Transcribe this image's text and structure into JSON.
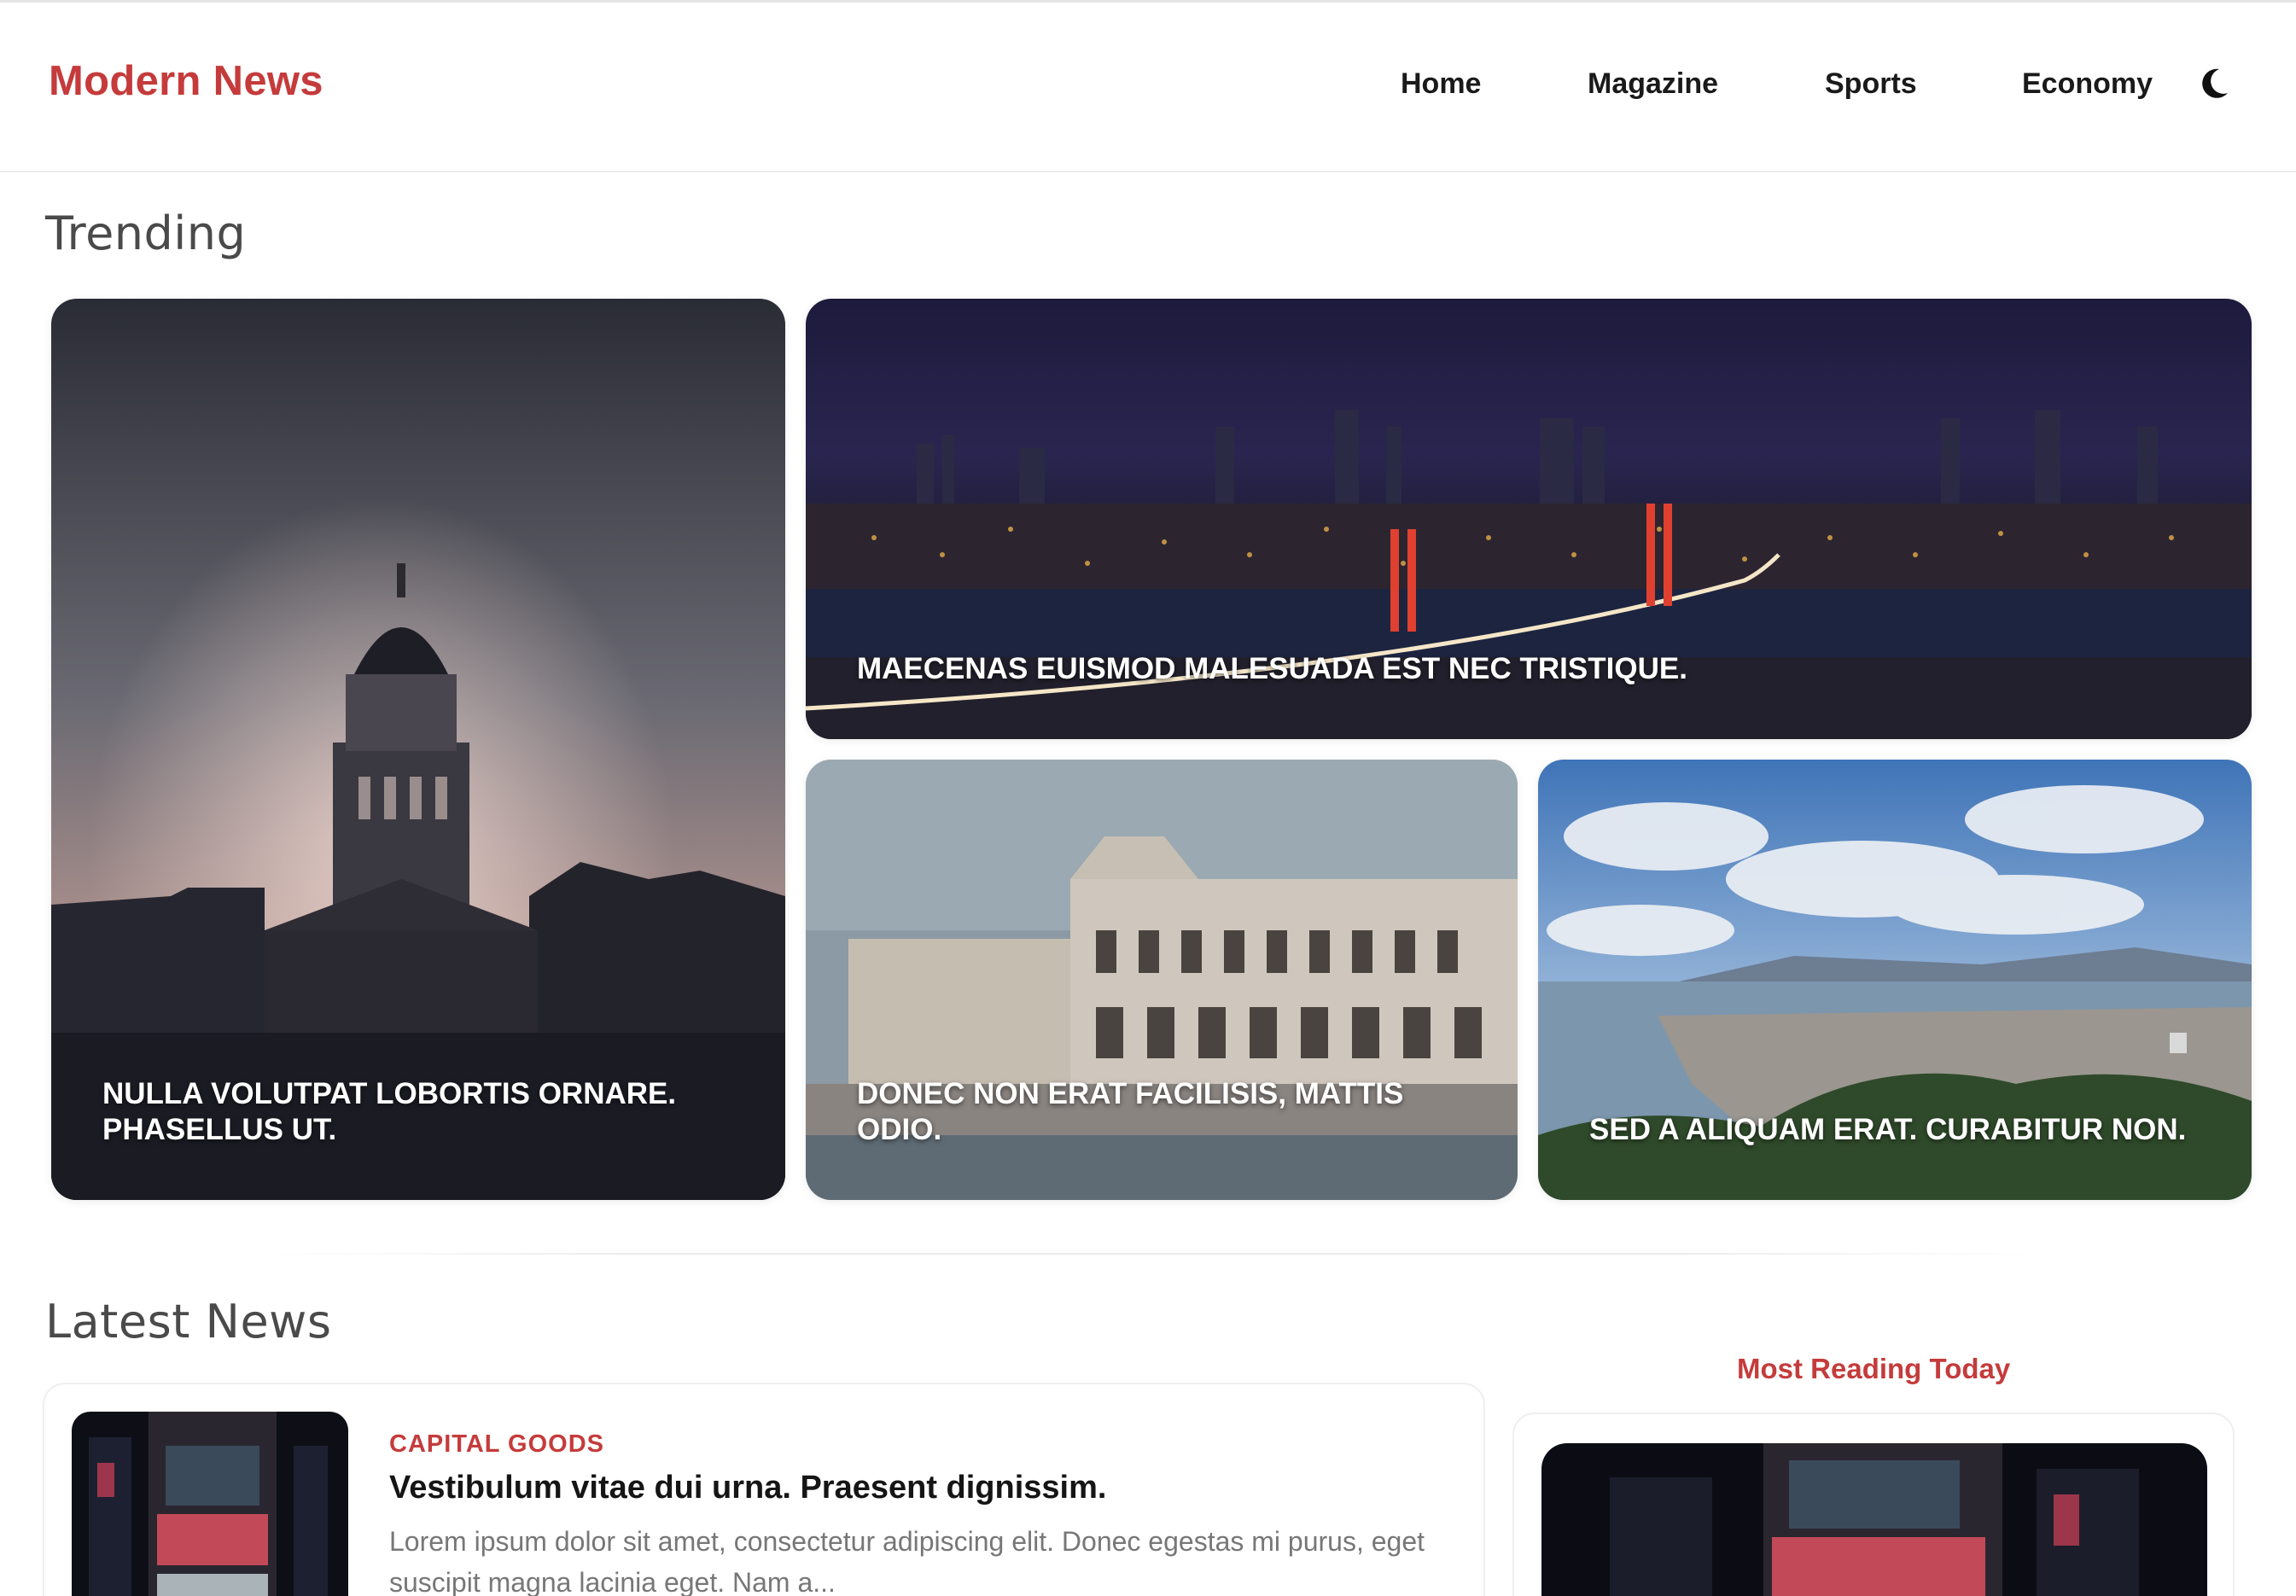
{
  "header": {
    "logo": "Modern News",
    "nav": [
      {
        "label": "Home"
      },
      {
        "label": "Magazine"
      },
      {
        "label": "Sports"
      },
      {
        "label": "Economy"
      }
    ],
    "theme_icon": "moon-icon"
  },
  "trending": {
    "title": "Trending",
    "cards": [
      {
        "title": "Nulla volutpat lobortis ornare. Phasellus ut.",
        "image": "cathedral-dusk"
      },
      {
        "title": "Maecenas euismod malesuada est nec tristique.",
        "image": "city-bridge-night"
      },
      {
        "title": "Donec non erat facilisis, mattis odio.",
        "image": "waterfront-station"
      },
      {
        "title": "Sed a aliquam erat. Curabitur non.",
        "image": "coastal-city-cable-car"
      }
    ]
  },
  "latest": {
    "title": "Latest News",
    "article": {
      "category": "CAPITAL GOODS",
      "title": "Vestibulum vitae dui urna. Praesent dignissim.",
      "excerpt": "Lorem ipsum dolor sit amet, consectetur adipiscing elit. Donec egestas mi purus, eget suscipit magna lacinia eget. Nam a...",
      "image": "neon-street-night"
    }
  },
  "sidebar": {
    "title": "Most Reading Today",
    "image": "neon-street-night"
  },
  "colors": {
    "accent": "#c53b3b",
    "text": "#1a1a1a",
    "muted": "#777777"
  }
}
